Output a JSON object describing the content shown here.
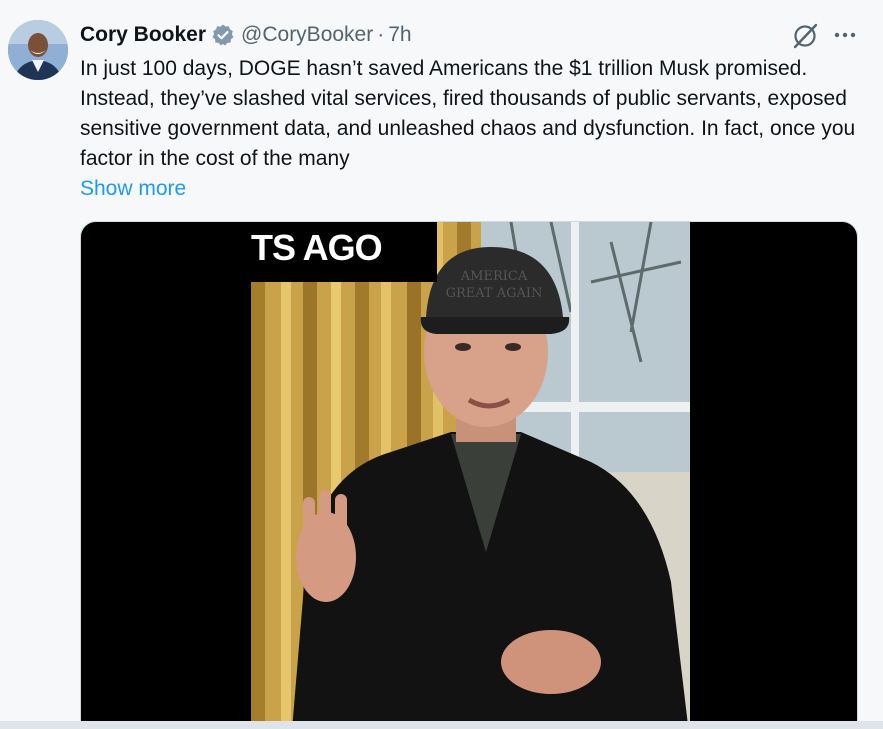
{
  "tweet": {
    "author_name": "Cory Booker",
    "handle": "@CoryBooker",
    "separator": "·",
    "time": "7h",
    "text": "In just 100 days, DOGE hasn’t saved Americans the $1 trillion Musk promised. Instead, they’ve slashed vital services, fired thousands of public servants, exposed sensitive government data, and unleashed chaos and dysfunction. In fact, once you factor in the cost of the many",
    "show_more": "Show more"
  },
  "media": {
    "overlay_text": "TS AGO"
  },
  "icons": {
    "verified": "verified-badge-icon",
    "grok": "grok-icon",
    "more": "more-options-icon"
  },
  "colors": {
    "link": "#1d9bf0",
    "secondary_text": "#536471",
    "background": "#f7f8f9"
  }
}
